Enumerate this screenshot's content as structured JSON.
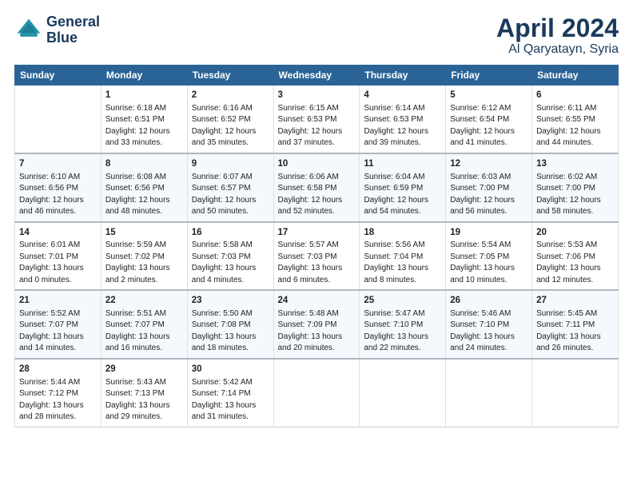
{
  "header": {
    "logo_line1": "General",
    "logo_line2": "Blue",
    "title": "April 2024",
    "location": "Al Qaryatayn, Syria"
  },
  "days_header": [
    "Sunday",
    "Monday",
    "Tuesday",
    "Wednesday",
    "Thursday",
    "Friday",
    "Saturday"
  ],
  "weeks": [
    [
      {
        "num": "",
        "info": ""
      },
      {
        "num": "1",
        "info": "Sunrise: 6:18 AM\nSunset: 6:51 PM\nDaylight: 12 hours\nand 33 minutes."
      },
      {
        "num": "2",
        "info": "Sunrise: 6:16 AM\nSunset: 6:52 PM\nDaylight: 12 hours\nand 35 minutes."
      },
      {
        "num": "3",
        "info": "Sunrise: 6:15 AM\nSunset: 6:53 PM\nDaylight: 12 hours\nand 37 minutes."
      },
      {
        "num": "4",
        "info": "Sunrise: 6:14 AM\nSunset: 6:53 PM\nDaylight: 12 hours\nand 39 minutes."
      },
      {
        "num": "5",
        "info": "Sunrise: 6:12 AM\nSunset: 6:54 PM\nDaylight: 12 hours\nand 41 minutes."
      },
      {
        "num": "6",
        "info": "Sunrise: 6:11 AM\nSunset: 6:55 PM\nDaylight: 12 hours\nand 44 minutes."
      }
    ],
    [
      {
        "num": "7",
        "info": "Sunrise: 6:10 AM\nSunset: 6:56 PM\nDaylight: 12 hours\nand 46 minutes."
      },
      {
        "num": "8",
        "info": "Sunrise: 6:08 AM\nSunset: 6:56 PM\nDaylight: 12 hours\nand 48 minutes."
      },
      {
        "num": "9",
        "info": "Sunrise: 6:07 AM\nSunset: 6:57 PM\nDaylight: 12 hours\nand 50 minutes."
      },
      {
        "num": "10",
        "info": "Sunrise: 6:06 AM\nSunset: 6:58 PM\nDaylight: 12 hours\nand 52 minutes."
      },
      {
        "num": "11",
        "info": "Sunrise: 6:04 AM\nSunset: 6:59 PM\nDaylight: 12 hours\nand 54 minutes."
      },
      {
        "num": "12",
        "info": "Sunrise: 6:03 AM\nSunset: 7:00 PM\nDaylight: 12 hours\nand 56 minutes."
      },
      {
        "num": "13",
        "info": "Sunrise: 6:02 AM\nSunset: 7:00 PM\nDaylight: 12 hours\nand 58 minutes."
      }
    ],
    [
      {
        "num": "14",
        "info": "Sunrise: 6:01 AM\nSunset: 7:01 PM\nDaylight: 13 hours\nand 0 minutes."
      },
      {
        "num": "15",
        "info": "Sunrise: 5:59 AM\nSunset: 7:02 PM\nDaylight: 13 hours\nand 2 minutes."
      },
      {
        "num": "16",
        "info": "Sunrise: 5:58 AM\nSunset: 7:03 PM\nDaylight: 13 hours\nand 4 minutes."
      },
      {
        "num": "17",
        "info": "Sunrise: 5:57 AM\nSunset: 7:03 PM\nDaylight: 13 hours\nand 6 minutes."
      },
      {
        "num": "18",
        "info": "Sunrise: 5:56 AM\nSunset: 7:04 PM\nDaylight: 13 hours\nand 8 minutes."
      },
      {
        "num": "19",
        "info": "Sunrise: 5:54 AM\nSunset: 7:05 PM\nDaylight: 13 hours\nand 10 minutes."
      },
      {
        "num": "20",
        "info": "Sunrise: 5:53 AM\nSunset: 7:06 PM\nDaylight: 13 hours\nand 12 minutes."
      }
    ],
    [
      {
        "num": "21",
        "info": "Sunrise: 5:52 AM\nSunset: 7:07 PM\nDaylight: 13 hours\nand 14 minutes."
      },
      {
        "num": "22",
        "info": "Sunrise: 5:51 AM\nSunset: 7:07 PM\nDaylight: 13 hours\nand 16 minutes."
      },
      {
        "num": "23",
        "info": "Sunrise: 5:50 AM\nSunset: 7:08 PM\nDaylight: 13 hours\nand 18 minutes."
      },
      {
        "num": "24",
        "info": "Sunrise: 5:48 AM\nSunset: 7:09 PM\nDaylight: 13 hours\nand 20 minutes."
      },
      {
        "num": "25",
        "info": "Sunrise: 5:47 AM\nSunset: 7:10 PM\nDaylight: 13 hours\nand 22 minutes."
      },
      {
        "num": "26",
        "info": "Sunrise: 5:46 AM\nSunset: 7:10 PM\nDaylight: 13 hours\nand 24 minutes."
      },
      {
        "num": "27",
        "info": "Sunrise: 5:45 AM\nSunset: 7:11 PM\nDaylight: 13 hours\nand 26 minutes."
      }
    ],
    [
      {
        "num": "28",
        "info": "Sunrise: 5:44 AM\nSunset: 7:12 PM\nDaylight: 13 hours\nand 28 minutes."
      },
      {
        "num": "29",
        "info": "Sunrise: 5:43 AM\nSunset: 7:13 PM\nDaylight: 13 hours\nand 29 minutes."
      },
      {
        "num": "30",
        "info": "Sunrise: 5:42 AM\nSunset: 7:14 PM\nDaylight: 13 hours\nand 31 minutes."
      },
      {
        "num": "",
        "info": ""
      },
      {
        "num": "",
        "info": ""
      },
      {
        "num": "",
        "info": ""
      },
      {
        "num": "",
        "info": ""
      }
    ]
  ]
}
